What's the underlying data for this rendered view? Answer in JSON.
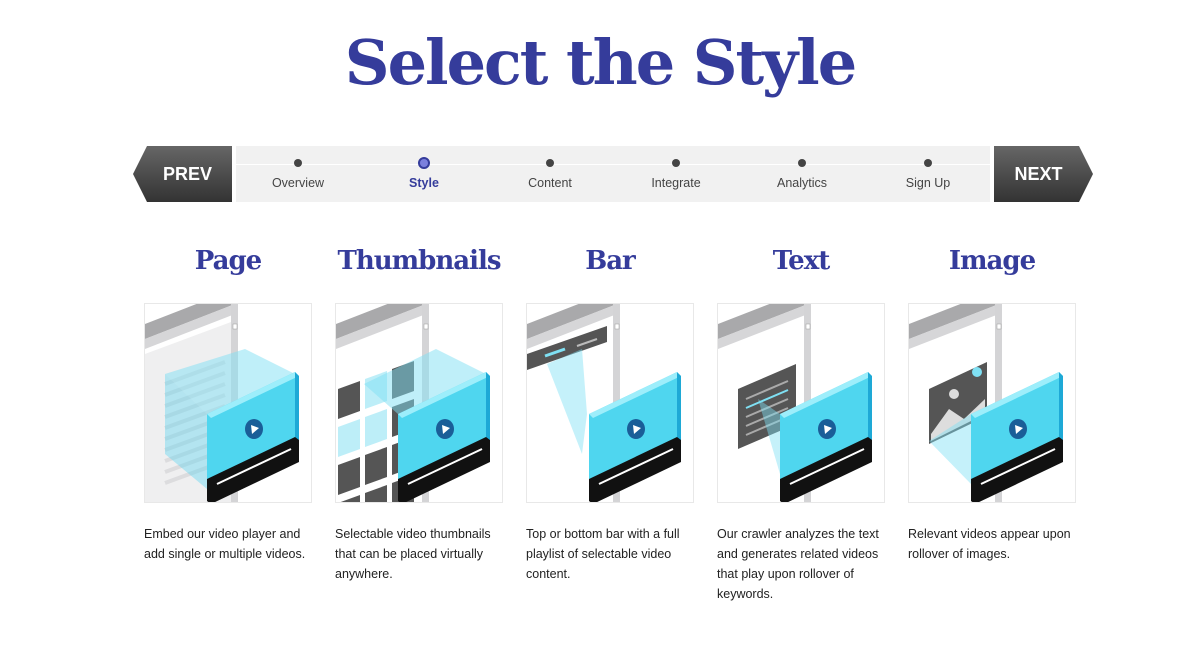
{
  "title": "Select the Style",
  "nav": {
    "prev": "PREV",
    "next": "NEXT",
    "steps": [
      {
        "label": "Overview"
      },
      {
        "label": "Style",
        "active": true
      },
      {
        "label": "Content"
      },
      {
        "label": "Integrate"
      },
      {
        "label": "Analytics"
      },
      {
        "label": "Sign Up"
      }
    ]
  },
  "styles": [
    {
      "name": "Page",
      "variant": "page",
      "desc": "Embed our video player and add single or multiple videos."
    },
    {
      "name": "Thumbnails",
      "variant": "thumbs",
      "desc": "Selectable video thumbnails that can be placed virtually anywhere."
    },
    {
      "name": "Bar",
      "variant": "bar",
      "desc": "Top or bottom bar with a full playlist of selectable video content."
    },
    {
      "name": "Text",
      "variant": "text",
      "desc": "Our crawler analyzes the text and generates related videos that play upon rollover of keywords."
    },
    {
      "name": "Image",
      "variant": "image",
      "desc": "Relevant videos appear upon rollover of images."
    }
  ],
  "colors": {
    "brand": "#353c9b",
    "device": "#3fd0ec"
  }
}
